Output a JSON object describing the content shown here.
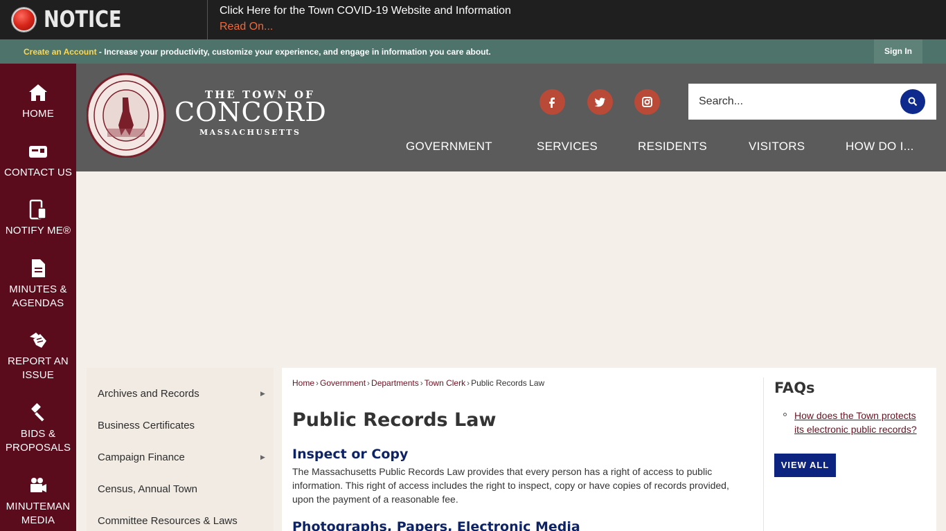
{
  "notice": {
    "label": "NOTICE",
    "headline": "Click Here for the Town COVID-19 Website and Information",
    "read_on": "Read On..."
  },
  "account_bar": {
    "create_account": "Create an Account",
    "tagline": " - Increase your productivity, customize your experience, and engage in information you care about.",
    "sign_in": "Sign In"
  },
  "sidebar": {
    "items": [
      {
        "label": "HOME",
        "icon": "home-icon"
      },
      {
        "label": "CONTACT US",
        "icon": "contact-card-icon"
      },
      {
        "label": "NOTIFY ME®",
        "icon": "devices-icon"
      },
      {
        "label": "MINUTES & AGENDAS",
        "icon": "document-icon"
      },
      {
        "label": "REPORT AN ISSUE",
        "icon": "hands-icon"
      },
      {
        "label": "BIDS & PROPOSALS",
        "icon": "gavel-icon"
      },
      {
        "label": "MINUTEMAN MEDIA",
        "icon": "video-camera-icon"
      }
    ]
  },
  "header": {
    "seal_text": "QVAM FIRMA RES CONCORDIA · CONCORD INCORPORATED 1635",
    "logo_top": "THE TOWN OF",
    "logo_main": "CONCORD",
    "logo_sub": "MASSACHUSETTS",
    "social": [
      "facebook-icon",
      "twitter-icon",
      "instagram-icon"
    ],
    "search_placeholder": "Search...",
    "nav": [
      "GOVERNMENT",
      "SERVICES",
      "RESIDENTS",
      "VISITORS",
      "HOW DO I..."
    ]
  },
  "subnav": {
    "items": [
      {
        "label": "Archives and Records",
        "has_children": true
      },
      {
        "label": "Business Certificates",
        "has_children": false
      },
      {
        "label": "Campaign Finance",
        "has_children": true
      },
      {
        "label": "Census, Annual Town",
        "has_children": false
      },
      {
        "label": "Committee Resources & Laws",
        "has_children": false
      }
    ]
  },
  "breadcrumb": [
    "Home",
    "Government",
    "Departments",
    "Town Clerk",
    "Public Records Law"
  ],
  "main": {
    "title": "Public Records Law",
    "section1_heading": "Inspect or Copy",
    "section1_text": "The Massachusetts Public Records Law provides that every person has a right of access to public information. This right of access includes the right to inspect, copy or have copies of records provided, upon the payment of a reasonable fee.",
    "section2_heading": "Photographs, Papers, Electronic Media"
  },
  "faqs": {
    "title": "FAQs",
    "items": [
      "How does the Town protects its electronic public records?"
    ],
    "view_all": "VIEW ALL"
  },
  "colors": {
    "sidebar": "#5a0c1c",
    "header": "#5b5b5b",
    "account_bar": "#4d736b",
    "social": "#b94a37",
    "accent_blue": "#0d2380"
  }
}
